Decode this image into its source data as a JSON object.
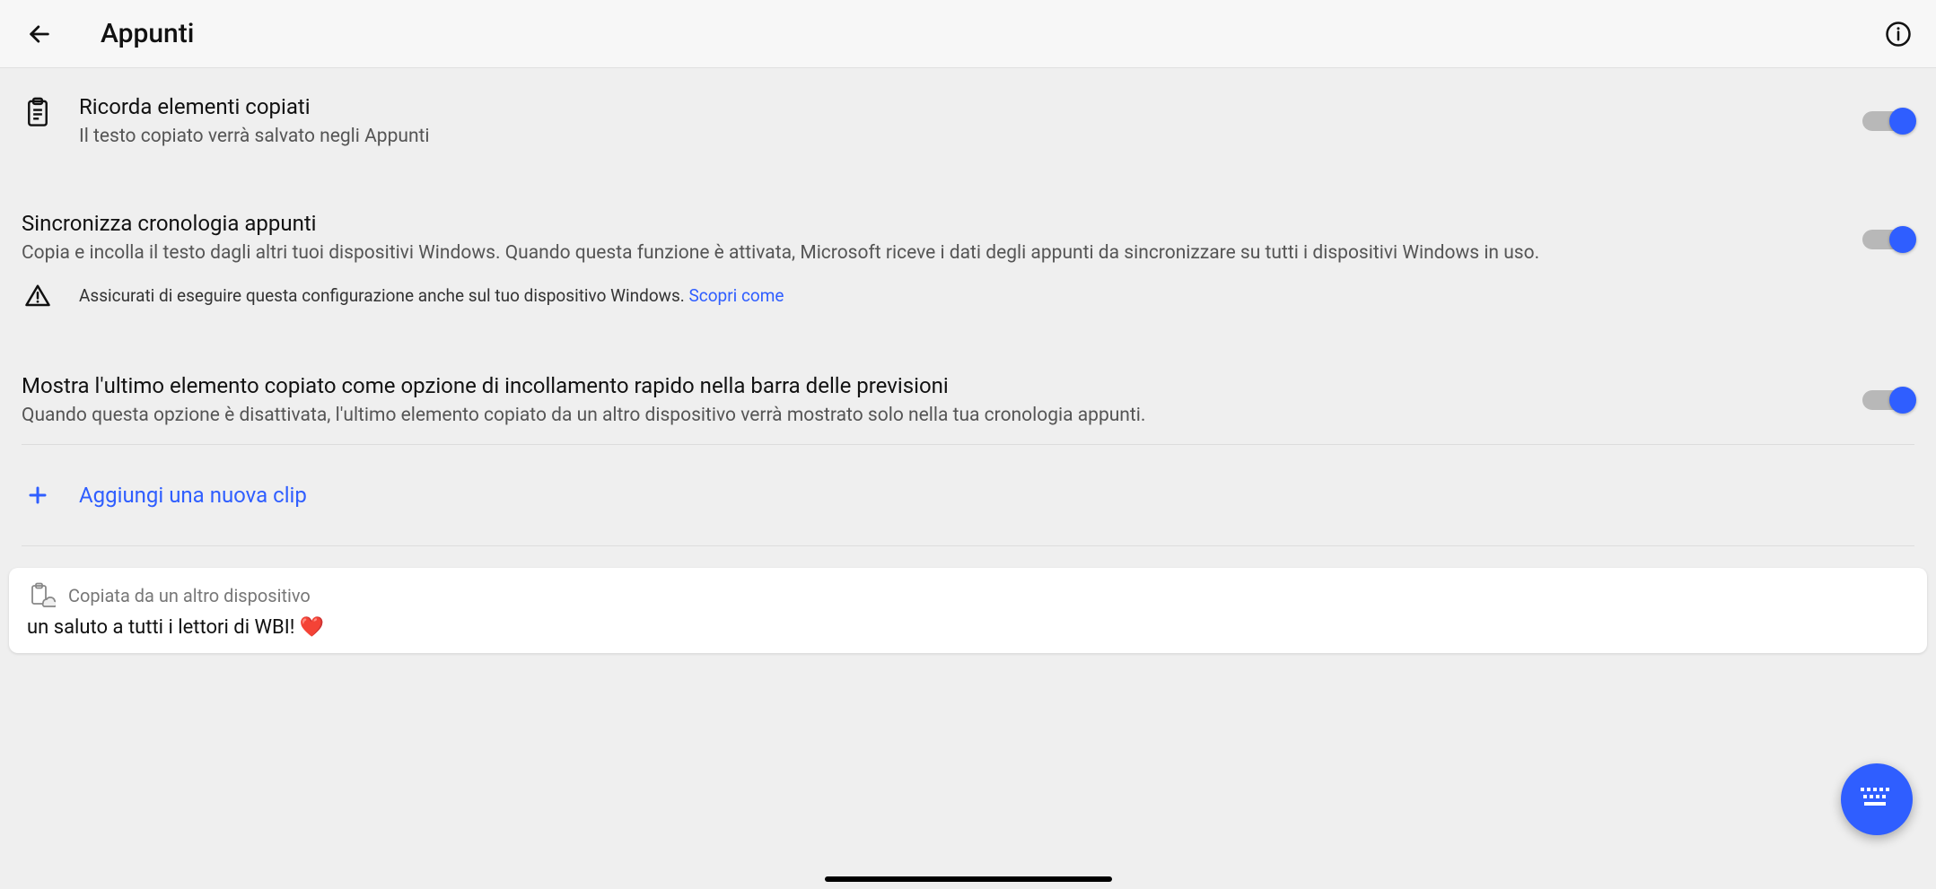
{
  "header": {
    "title": "Appunti"
  },
  "settings": {
    "remember": {
      "title": "Ricorda elementi copiati",
      "desc": "Il testo copiato verrà salvato negli Appunti"
    },
    "sync": {
      "title": "Sincronizza cronologia appunti",
      "desc": "Copia e incolla il testo dagli altri tuoi dispositivi Windows. Quando questa funzione è attivata, Microsoft riceve i dati degli appunti da sincronizzare su tutti i dispositivi Windows in uso.",
      "warning_text": "Assicurati di eseguire questa configurazione anche sul tuo dispositivo Windows. ",
      "warning_link": "Scopri come"
    },
    "show_last": {
      "title": "Mostra l'ultimo elemento copiato come opzione di incollamento rapido nella barra delle previsioni",
      "desc": "Quando questa opzione è disattivata, l'ultimo elemento copiato da un altro dispositivo verrà mostrato solo nella tua cronologia appunti."
    }
  },
  "add_clip": {
    "label": "Aggiungi una nuova clip"
  },
  "clip": {
    "source": "Copiata da un altro dispositivo",
    "text": "un saluto a tutti i lettori di WBI! ",
    "emoji": "❤️"
  }
}
